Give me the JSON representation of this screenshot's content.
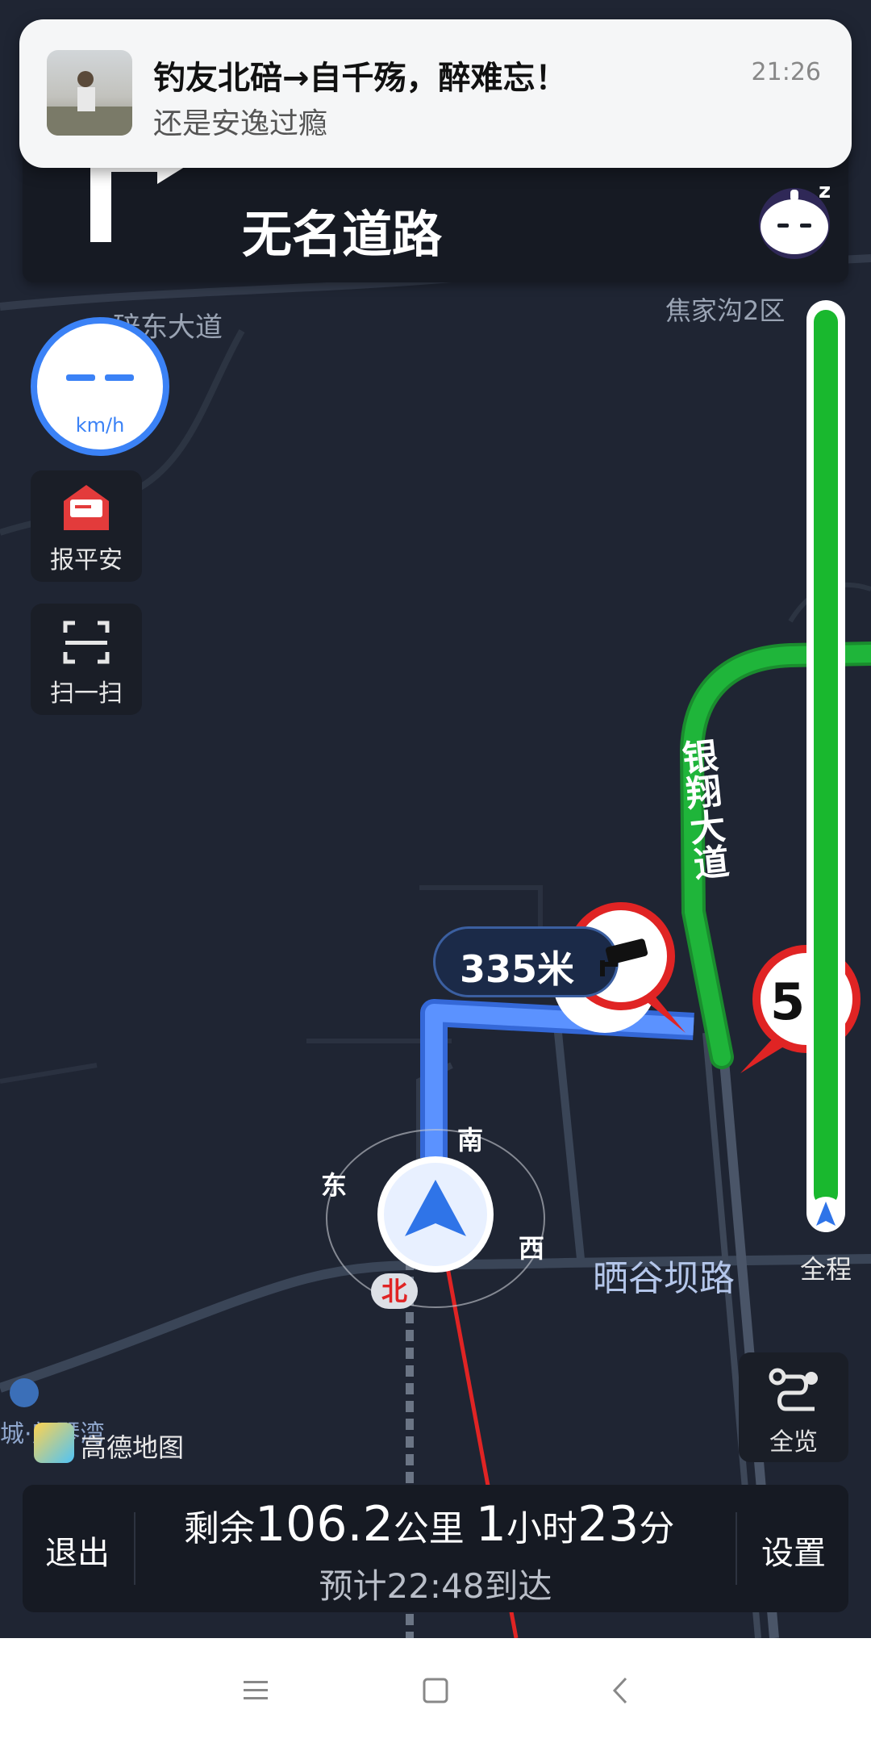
{
  "notification": {
    "title": "钓友北碚→自千殇，醉难忘！",
    "message": "还是安逸过瘾",
    "time": "21:26"
  },
  "guidance": {
    "road_name": "无名道路"
  },
  "speed_meter": {
    "value": "– –",
    "unit": "km/h"
  },
  "side_buttons": {
    "safety": "报平安",
    "scan": "扫一扫"
  },
  "map": {
    "labels": {
      "yinxiang": "银翔大道",
      "shaiguba": "晒谷坝路",
      "jiajiagou": "焦家沟2区",
      "dongdadao": "碚东大道",
      "qinwan": "城·朗琴湾"
    },
    "camera_distance": "335米",
    "speed_limit": "5",
    "compass": {
      "south": "南",
      "east": "东",
      "west": "西",
      "north": "北"
    }
  },
  "route_progress": {
    "label": "全程",
    "fraction_remaining": 1.0,
    "color": "#19b82e"
  },
  "overview_button": {
    "label": "全览"
  },
  "brand": {
    "name": "高德地图"
  },
  "bottom_bar": {
    "exit": "退出",
    "settings": "设置",
    "remain_prefix": "剩余",
    "remain_km": "106.2",
    "remain_unit": "公里",
    "hours": "1",
    "hours_unit": "小时",
    "minutes": "23",
    "minutes_unit": "分",
    "eta_prefix": "预计",
    "eta_time": "22:48",
    "eta_suffix": "到达"
  },
  "colors": {
    "accent_blue": "#3b82f6",
    "route_green": "#19b82e",
    "alert_red": "#e02424"
  }
}
